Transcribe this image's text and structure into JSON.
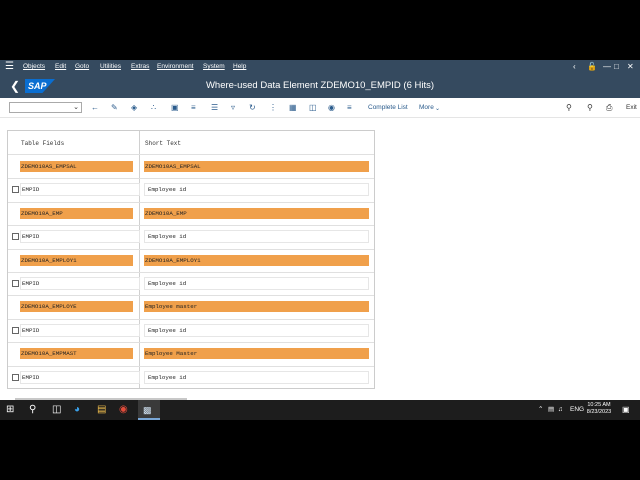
{
  "menubar": {
    "items": [
      "Objects",
      "Edit",
      "Goto",
      "Utilities",
      "Extras",
      "Environment",
      "System",
      "Help"
    ],
    "menu_icon": "hamburger-icon"
  },
  "titlebar": {
    "title": "Where-used Data Element ZDEMO10_EMPID (6 Hits)",
    "logo": "SAP"
  },
  "toolbar": {
    "dropdown_value": "",
    "complete_list": "Complete List",
    "more": "More",
    "exit": "Exit"
  },
  "table": {
    "headers": {
      "field": "Table Fields",
      "short": "Short Text"
    },
    "rows": [
      {
        "field": "ZDEMO10AS_EMPSAL",
        "short": "ZDEMO10AS_EMPSAL",
        "type": "table"
      },
      {
        "field": "EMPID",
        "short": "Employee id",
        "type": "field"
      },
      {
        "field": "ZDEMO10A_EMP",
        "short": "ZDEMO10A_EMP",
        "type": "table"
      },
      {
        "field": "EMPID",
        "short": "Employee id",
        "type": "field"
      },
      {
        "field": "ZDEMO10A_EMPLOY1",
        "short": "ZDEMO10A_EMPLOY1",
        "type": "table"
      },
      {
        "field": "EMPID",
        "short": "Employee id",
        "type": "field"
      },
      {
        "field": "ZDEMO10A_EMPLOYE",
        "short": "Employee master",
        "type": "table"
      },
      {
        "field": "EMPID",
        "short": "Employee id",
        "type": "field"
      },
      {
        "field": "ZDEMO10A_EMPMAST",
        "short": "Employee Master",
        "type": "table"
      },
      {
        "field": "EMPID",
        "short": "Employee id",
        "type": "field"
      }
    ]
  },
  "taskbar": {
    "lang": "ENG",
    "time": "10:25 AM",
    "date": "8/23/2023"
  },
  "colors": {
    "shell": "#354a5f",
    "highlight": "#f0a04b",
    "sap_blue": "#0a6ed1"
  }
}
